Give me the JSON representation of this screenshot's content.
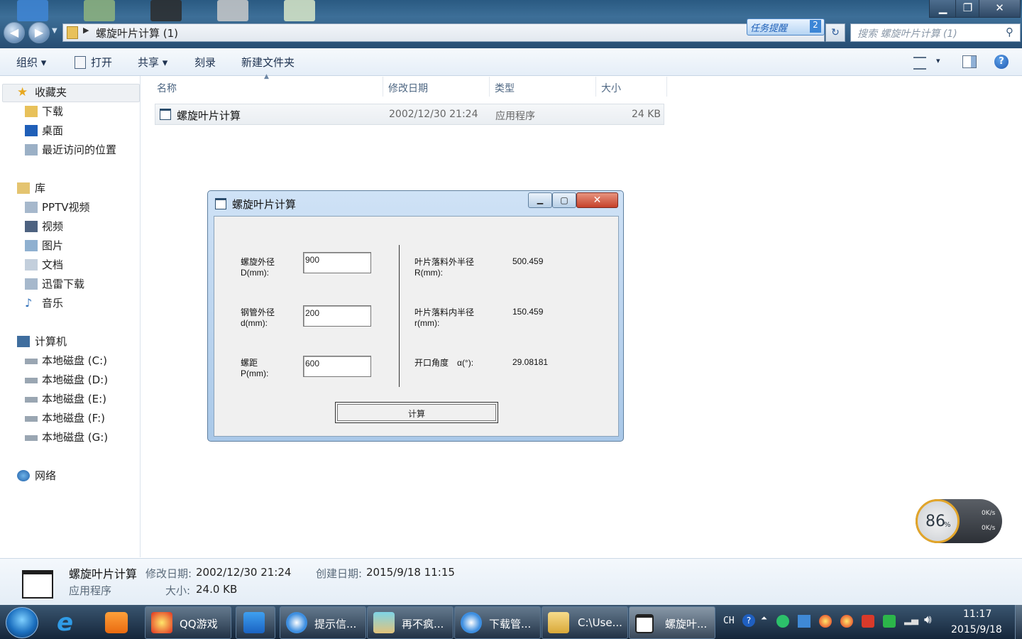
{
  "window": {
    "address_path": "螺旋叶片计算 (1)",
    "task_reminder": "任务提醒",
    "task_reminder_count": "2",
    "search_placeholder": "搜索 螺旋叶片计算 (1)",
    "minimize": "▁",
    "maximize": "❐",
    "close": "✕"
  },
  "toolbar": {
    "organize": "组织 ▾",
    "open": "打开",
    "share": "共享 ▾",
    "burn": "刻录",
    "new_folder": "新建文件夹",
    "view_menu": "▾",
    "help": "?"
  },
  "sidebar": {
    "favorites": "收藏夹",
    "downloads": "下载",
    "desktop": "桌面",
    "recent": "最近访问的位置",
    "libraries": "库",
    "pptv": "PPTV视频",
    "videos": "视频",
    "pictures": "图片",
    "documents": "文档",
    "xunlei": "迅雷下载",
    "music": "音乐",
    "computer": "计算机",
    "drive_c": "本地磁盘 (C:)",
    "drive_d": "本地磁盘 (D:)",
    "drive_e": "本地磁盘 (E:)",
    "drive_f": "本地磁盘 (F:)",
    "drive_g": "本地磁盘 (G:)",
    "network": "网络"
  },
  "file_list": {
    "columns": {
      "name": "名称",
      "modified": "修改日期",
      "type": "类型",
      "size": "大小"
    },
    "rows": [
      {
        "name": "螺旋叶片计算",
        "modified": "2002/12/30 21:24",
        "type": "应用程序",
        "size": "24 KB"
      }
    ]
  },
  "dialog": {
    "title": "螺旋叶片计算",
    "outer_diameter_label_1": "螺旋外径",
    "outer_diameter_label_2": "D(mm):",
    "outer_diameter_value": "900",
    "pipe_diameter_label_1": "钢管外径",
    "pipe_diameter_label_2": "d(mm):",
    "pipe_diameter_value": "200",
    "pitch_label_1": "螺距",
    "pitch_label_2": "P(mm):",
    "pitch_value": "600",
    "blank_outer_radius_label_1": "叶片落料外半径",
    "blank_outer_radius_label_2": "R(mm):",
    "blank_outer_radius_value": "500.459",
    "blank_inner_radius_label_1": "叶片落料内半径",
    "blank_inner_radius_label_2": "r(mm):",
    "blank_inner_radius_value": "150.459",
    "opening_angle_label": "开口角度　α(°):",
    "opening_angle_value": "29.08181",
    "calculate_button": "计算"
  },
  "details": {
    "name": "螺旋叶片计算",
    "modified_label": "修改日期:",
    "modified_value": "2002/12/30 21:24",
    "created_label": "创建日期:",
    "created_value": "2015/9/18 11:15",
    "type": "应用程序",
    "size_label": "大小:",
    "size_value": "24.0 KB"
  },
  "speed_widget": {
    "percent": "86",
    "percent_unit": "%",
    "up": "0K/s",
    "down": "0K/s"
  },
  "taskbar": {
    "qqgame": "QQ游戏",
    "tip": "提示信...",
    "zaibufeng": "再不疯...",
    "download_mgr": "下载管...",
    "explorer": "C:\\Use...",
    "calc_app": "螺旋叶...",
    "lang": "CH",
    "time": "11:17",
    "date": "2015/9/18"
  }
}
